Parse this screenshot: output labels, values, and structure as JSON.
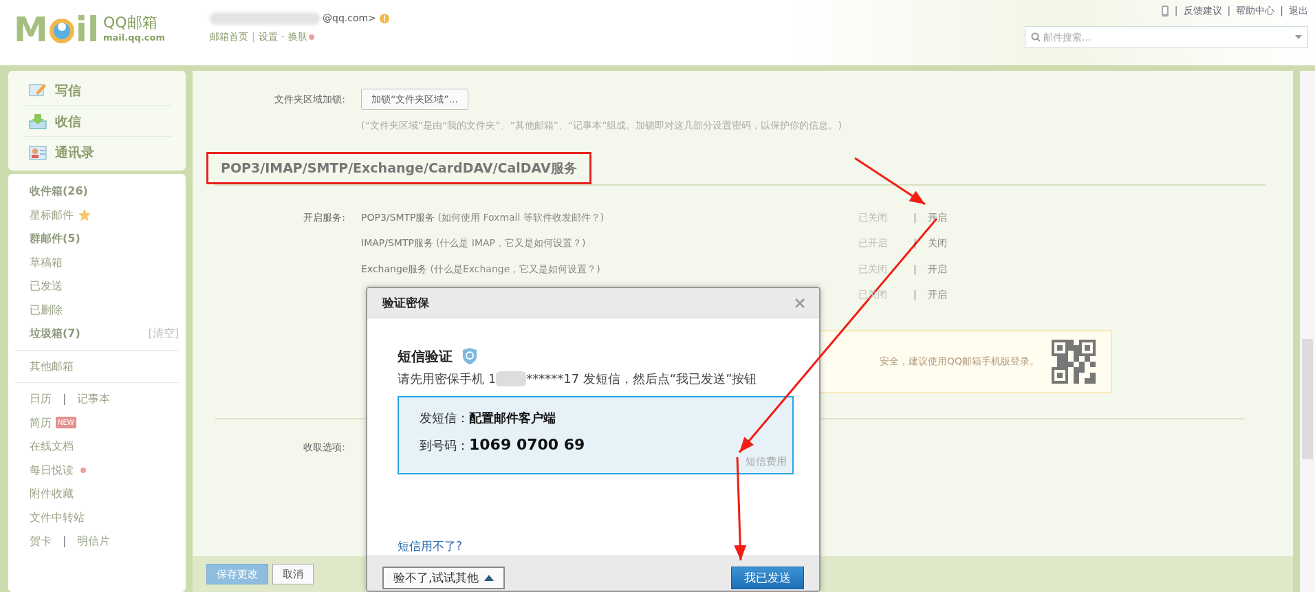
{
  "header": {
    "logo": {
      "left": "M",
      "right": "il",
      "name": "QQ邮箱",
      "domain": "mail.qq.com"
    },
    "account": "@qq.com>",
    "links": [
      {
        "kind": "link",
        "text": "邮箱首页"
      },
      {
        "kind": "separator",
        "text": "|"
      },
      {
        "kind": "link",
        "text": "设置"
      },
      {
        "kind": "separator",
        "text": "-"
      },
      {
        "kind": "link",
        "text": "换肤"
      }
    ],
    "top_links": [
      {
        "kind": "separator",
        "text": "|"
      },
      {
        "kind": "link",
        "text": "反馈建议"
      },
      {
        "kind": "separator",
        "text": "|"
      },
      {
        "kind": "link",
        "text": "帮助中心"
      },
      {
        "kind": "separator",
        "text": "|"
      },
      {
        "kind": "link",
        "text": "退出"
      }
    ],
    "search": {
      "placeholder": "邮件搜索..."
    }
  },
  "sidebar": {
    "actions": [
      {
        "label": "写信",
        "kind": "write"
      },
      {
        "label": "收信",
        "kind": "receive"
      },
      {
        "label": "通讯录",
        "kind": "contacts"
      }
    ],
    "groups": [
      [
        {
          "kind": "single",
          "label": "收件箱(26)",
          "bold": true
        },
        {
          "kind": "starred",
          "label": "星标邮件",
          "bold": false
        },
        {
          "kind": "single",
          "label": "群邮件(5)",
          "bold": true
        },
        {
          "kind": "single",
          "label": "草稿箱",
          "bold": false
        },
        {
          "kind": "single",
          "label": "已发送",
          "bold": false
        },
        {
          "kind": "single",
          "label": "已删除",
          "bold": false
        },
        {
          "kind": "single",
          "label": "垃圾箱(7)",
          "bold": true,
          "extra": "[清空]"
        }
      ],
      [
        {
          "kind": "single",
          "label": "其他邮箱",
          "bold": false
        }
      ],
      [
        {
          "kind": "pair",
          "labels": [
            "日历",
            "记事本"
          ],
          "separator": "|"
        },
        {
          "kind": "badged",
          "label": "简历",
          "bold": false,
          "badge": "NEW"
        },
        {
          "kind": "single",
          "label": "在线文档",
          "bold": false
        },
        {
          "kind": "dotted",
          "label": "每日悦读",
          "bold": false
        },
        {
          "kind": "single",
          "label": "附件收藏",
          "bold": false
        },
        {
          "kind": "single",
          "label": "文件中转站",
          "bold": false
        },
        {
          "kind": "pair",
          "labels": [
            "贺卡",
            "明信片"
          ],
          "separator": "|"
        }
      ]
    ]
  },
  "settings": {
    "lock": {
      "label": "文件夹区域加锁:",
      "button": "加锁“文件夹区域”...",
      "note": "(“文件夹区域”是由“我的文件夹”、“其他邮箱”、“记事本”组成。加锁即对这几部分设置密码，以保护你的信息。)"
    },
    "section_title": "POP3/IMAP/SMTP/Exchange/CardDAV/CalDAV服务",
    "services_label": "开启服务:",
    "services": [
      {
        "name": "POP3/SMTP服务",
        "help": "(如何使用 Foxmail 等软件收发邮件？)",
        "status": "已关闭",
        "separator": "|",
        "action": "开启"
      },
      {
        "name": "IMAP/SMTP服务",
        "help": "(什么是 IMAP，它又是如何设置？)",
        "status": "已开启",
        "separator": "|",
        "action": "关闭"
      },
      {
        "name": "Exchange服务",
        "help": "(什么是Exchange，它又是如何设置？)",
        "status": "已关闭",
        "separator": "|",
        "action": "开启"
      },
      {
        "status": "已关闭",
        "separator": "|",
        "action": "开启"
      }
    ],
    "notice": "安全，建议使用QQ邮箱手机版登录。",
    "receive_label": "收取选项:",
    "buttons": [
      {
        "label": "保存更改",
        "kind": "primary"
      },
      {
        "label": "取消",
        "kind": "secondary"
      }
    ]
  },
  "dialog": {
    "title": "验证密保",
    "heading": "短信验证",
    "instruction_start": "请先用密保手机 1",
    "instruction_end": "******17 发短信，然后点“我已发送”按钮",
    "sms": [
      {
        "label": "发短信：",
        "value": "配置邮件客户端",
        "kind": "text"
      },
      {
        "label": "到号码：",
        "value": "1069 0700 69",
        "kind": "number"
      }
    ],
    "fee_link": "短信费用",
    "help_link": "短信用不了?",
    "other_button": "验不了,试试其他",
    "confirm_button": "我已发送"
  }
}
